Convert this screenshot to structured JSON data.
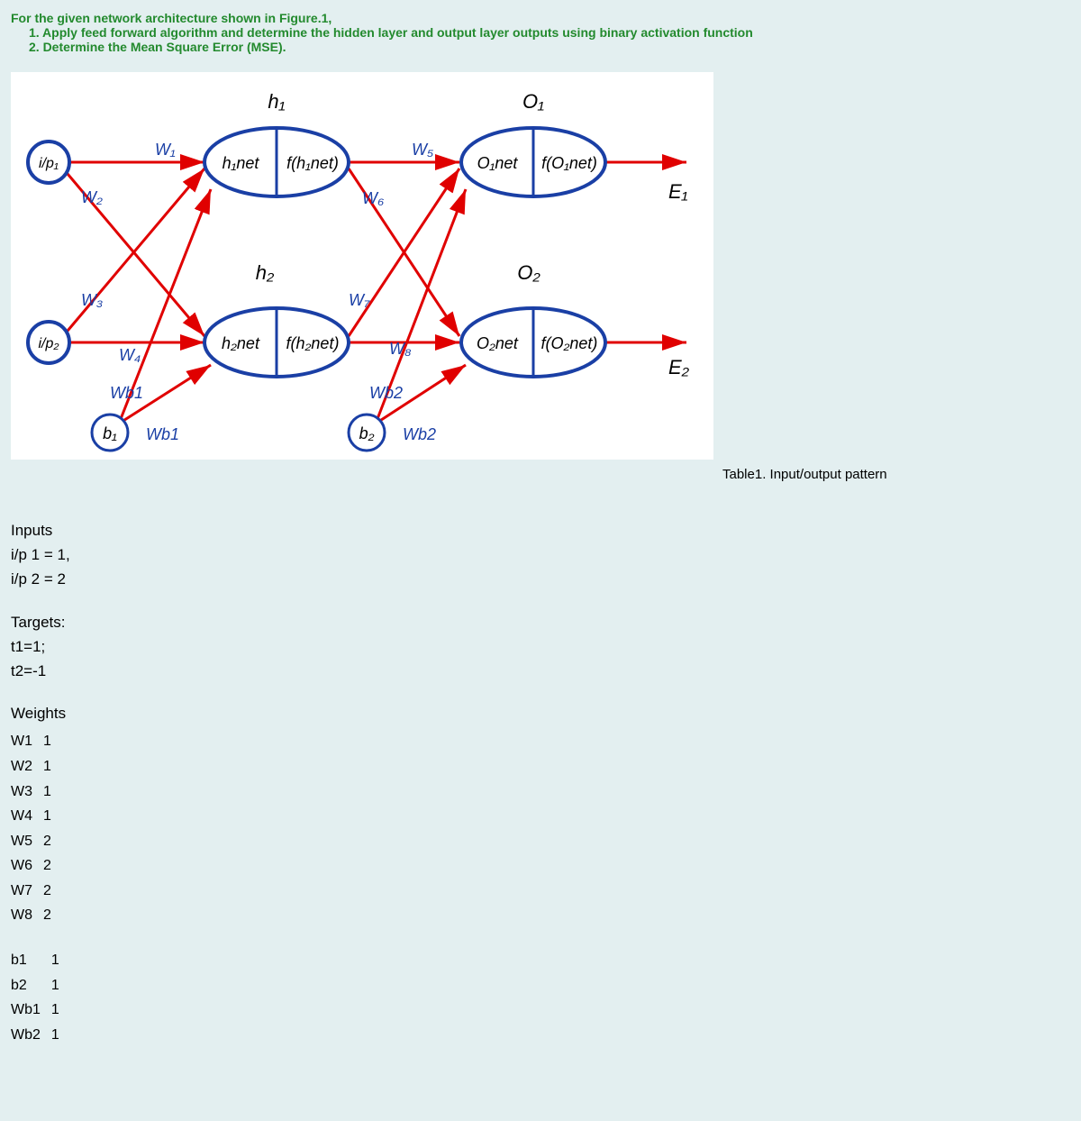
{
  "header": {
    "intro": "For the given network architecture shown in Figure.1,",
    "point1": "1. Apply feed forward algorithm and determine the hidden layer and output layer outputs using binary activation function",
    "point2": "2. Determine the Mean Square Error (MSE)."
  },
  "diagram": {
    "labels": {
      "ip1": "i/p₁",
      "ip2": "i/p₂",
      "b1": "b₁",
      "b2": "b₂",
      "h1_top": "h₁",
      "h2_top": "h₂",
      "h1_left": "h₁net",
      "h1_right": "f(h₁net)",
      "h2_left": "h₂net",
      "h2_right": "f(h₂net)",
      "o1_top": "O₁",
      "o2_top": "O₂",
      "o1_left": "O₁net",
      "o1_right": "f(O₁net)",
      "o2_left": "O₂net",
      "o2_right": "f(O₂net)",
      "E1": "E₁",
      "E2": "E₂",
      "W1": "W₁",
      "W2": "W₂",
      "W3": "W₃",
      "W4": "W₄",
      "W5": "W₅",
      "W6": "W₆",
      "W7": "W₇",
      "W8": "W₈",
      "Wb1a": "Wb1",
      "Wb1b": "Wb1",
      "Wb2a": "Wb2",
      "Wb2b": "Wb2"
    }
  },
  "caption": "Table1. Input/output pattern",
  "inputs": {
    "title": "Inputs",
    "line1": "i/p 1 = 1,",
    "line2": "i/p 2 = 2"
  },
  "targets": {
    "title": "Targets:",
    "line1": "t1=1;",
    "line2": "t2=-1"
  },
  "weights": {
    "title": "Weights",
    "rows": [
      {
        "name": "W1",
        "val": "1"
      },
      {
        "name": "W2",
        "val": "1"
      },
      {
        "name": "W3",
        "val": "1"
      },
      {
        "name": "W4",
        "val": "1"
      },
      {
        "name": "W5",
        "val": "2"
      },
      {
        "name": "W6",
        "val": "2"
      },
      {
        "name": "W7",
        "val": "2"
      },
      {
        "name": "W8",
        "val": "2"
      }
    ]
  },
  "biases": {
    "rows": [
      {
        "name": "b1",
        "val": "1"
      },
      {
        "name": "b2",
        "val": "1"
      },
      {
        "name": "Wb1",
        "val": "1"
      },
      {
        "name": "Wb2",
        "val": "1"
      }
    ]
  },
  "chart_data": {
    "type": "diagram",
    "architecture": "feedforward neural network 2-2-2 with biases",
    "inputs": [
      "i/p1",
      "i/p2"
    ],
    "hidden": [
      "h1",
      "h2"
    ],
    "outputs": [
      "O1",
      "O2"
    ],
    "biases": [
      "b1",
      "b2"
    ],
    "edges": [
      {
        "from": "i/p1",
        "to": "h1",
        "w": "W1"
      },
      {
        "from": "i/p1",
        "to": "h2",
        "w": "W2"
      },
      {
        "from": "i/p2",
        "to": "h1",
        "w": "W3"
      },
      {
        "from": "i/p2",
        "to": "h2",
        "w": "W4"
      },
      {
        "from": "b1",
        "to": "h1",
        "w": "Wb1"
      },
      {
        "from": "b1",
        "to": "h2",
        "w": "Wb1"
      },
      {
        "from": "h1",
        "to": "O1",
        "w": "W5"
      },
      {
        "from": "h1",
        "to": "O2",
        "w": "W6"
      },
      {
        "from": "h2",
        "to": "O1",
        "w": "W7"
      },
      {
        "from": "h2",
        "to": "O2",
        "w": "W8"
      },
      {
        "from": "b2",
        "to": "O1",
        "w": "Wb2"
      },
      {
        "from": "b2",
        "to": "O2",
        "w": "Wb2"
      },
      {
        "from": "O1",
        "to": "E1"
      },
      {
        "from": "O2",
        "to": "E2"
      }
    ]
  }
}
